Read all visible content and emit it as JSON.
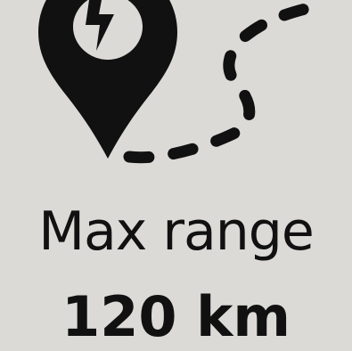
{
  "metric": {
    "title": "Max range",
    "value": "120 km"
  },
  "icons": {
    "pin": "location-pin-icon",
    "bolt": "lightning-bolt-icon",
    "route": "dashed-route-icon"
  },
  "colors": {
    "background": "#dcdad7",
    "foreground": "#111111"
  }
}
